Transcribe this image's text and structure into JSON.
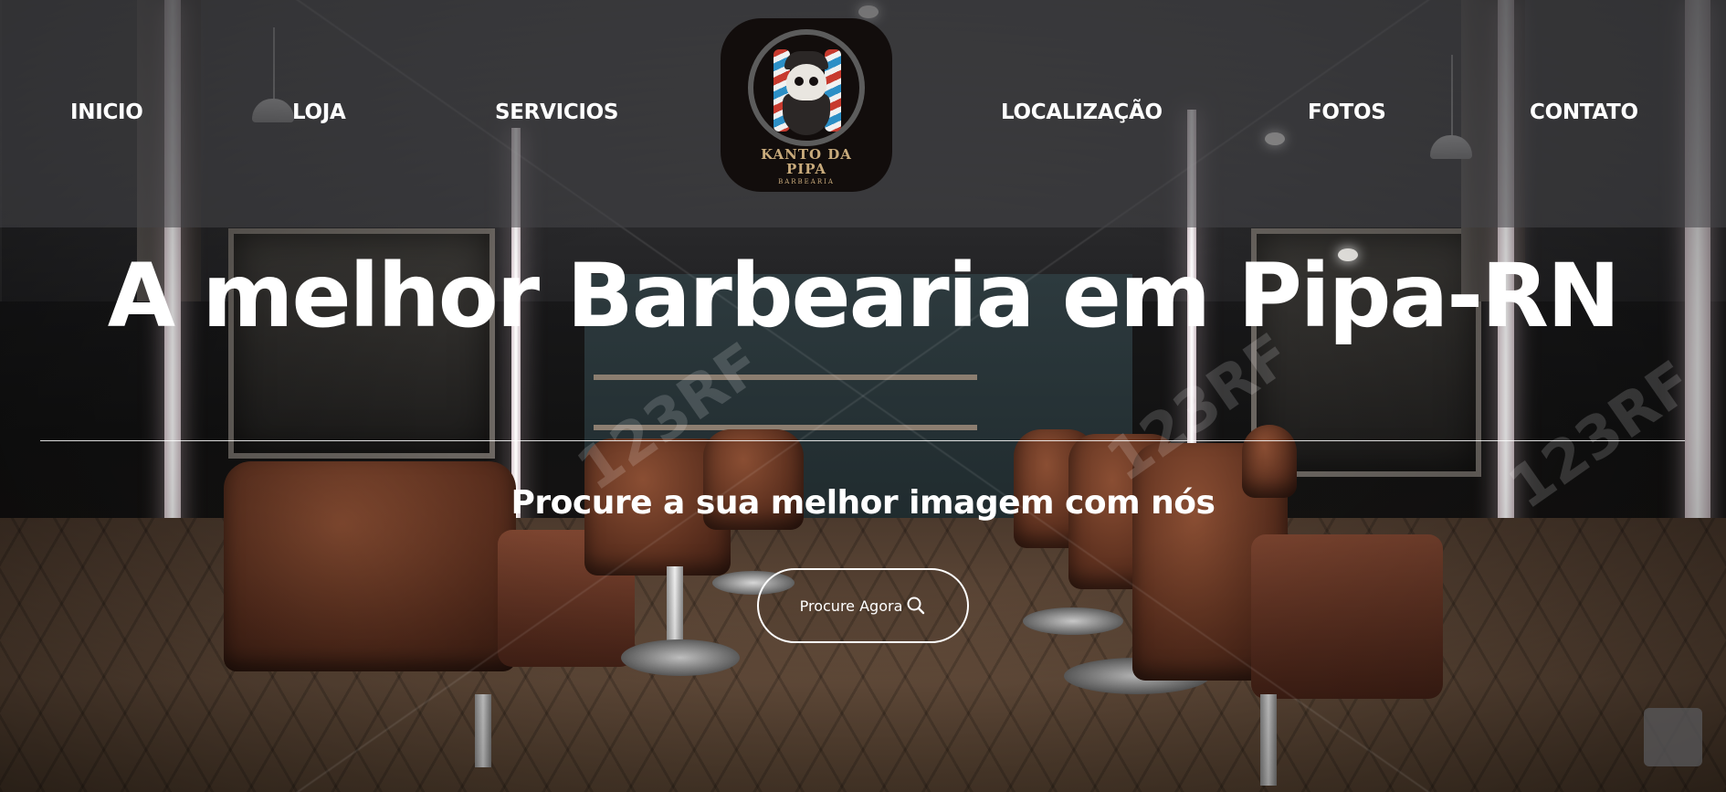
{
  "nav": {
    "items": [
      {
        "label": "INICIO"
      },
      {
        "label": "LOJA"
      },
      {
        "label": "SERVICIOS"
      },
      {
        "label": "LOCALIZAÇÃO"
      },
      {
        "label": "FOTOS"
      },
      {
        "label": "CONTATO"
      }
    ]
  },
  "logo": {
    "name": "KANTO DA\nPIPA",
    "subtitle": "BARBEARIA"
  },
  "hero": {
    "title": "A melhor Barbearia em Pipa-RN",
    "subtitle": "Procure a sua melhor imagem com nós",
    "cta_label": "Procure Agora",
    "cta_icon": "search-icon"
  },
  "watermark": {
    "text": "123RF"
  },
  "colors": {
    "header_overlay": "#464648",
    "logo_bg": "#120d0c",
    "logo_text": "#c9ab7c",
    "text": "#ffffff"
  }
}
